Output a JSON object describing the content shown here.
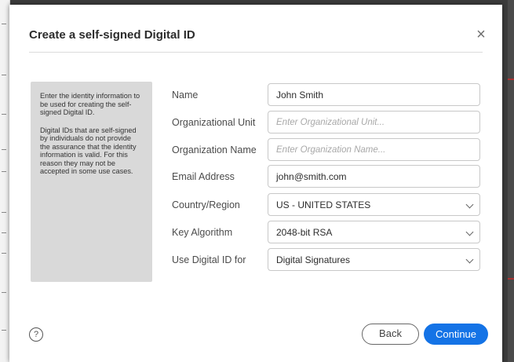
{
  "dialog": {
    "title": "Create a self-signed Digital ID",
    "close_glyph": "×"
  },
  "info": {
    "paragraph1": "Enter the identity information to be used for creating the self-signed Digital ID.",
    "paragraph2": "Digital IDs that are self-signed by individuals do not provide the assurance that the identity information is valid. For this reason they may not be accepted in some use cases."
  },
  "form": {
    "name": {
      "label": "Name",
      "value": "John Smith"
    },
    "org_unit": {
      "label": "Organizational Unit",
      "placeholder": "Enter Organizational Unit..."
    },
    "org_name": {
      "label": "Organization Name",
      "placeholder": "Enter Organization Name..."
    },
    "email": {
      "label": "Email Address",
      "value": "john@smith.com"
    },
    "country": {
      "label": "Country/Region",
      "value": "US - UNITED STATES"
    },
    "key_algorithm": {
      "label": "Key Algorithm",
      "value": "2048-bit RSA"
    },
    "use_for": {
      "label": "Use Digital ID for",
      "value": "Digital Signatures"
    }
  },
  "footer": {
    "help_glyph": "?",
    "back_label": "Back",
    "continue_label": "Continue"
  },
  "colors": {
    "accent": "#1473e6",
    "info_bg": "#d9d9d9"
  },
  "icons": [
    "close-icon",
    "help-icon",
    "chevron-down-icon"
  ]
}
